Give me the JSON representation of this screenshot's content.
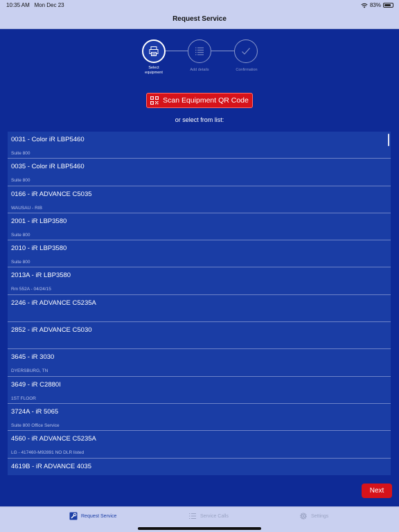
{
  "status_bar": {
    "time": "10:35 AM",
    "date": "Mon Dec 23",
    "battery": "83%",
    "battery_level": 0.83
  },
  "nav": {
    "title": "Request Service"
  },
  "stepper": {
    "steps": [
      {
        "label_line1": "Select",
        "label_line2": "equipment",
        "icon": "printer-icon",
        "state": "active"
      },
      {
        "label_line1": "Add details",
        "label_line2": "",
        "icon": "list-icon",
        "state": "inactive"
      },
      {
        "label_line1": "Confirmation",
        "label_line2": "",
        "icon": "checkmark-icon",
        "state": "inactive"
      }
    ]
  },
  "scan": {
    "label": "Scan Equipment QR Code",
    "icon": "qr-code-icon"
  },
  "or_select": "or select from list:",
  "equipment": [
    {
      "title": "0031 - Color iR LBP5460",
      "sub": "Suite 800"
    },
    {
      "title": "0035 - Color iR LBP5460",
      "sub": "Suite 800"
    },
    {
      "title": "0166 - iR ADVANCE C5035",
      "sub": "WAUSAU - RIB"
    },
    {
      "title": "2001 - iR LBP3580",
      "sub": "Suite 800"
    },
    {
      "title": "2010 - iR LBP3580",
      "sub": "Suite 800"
    },
    {
      "title": "2013A - iR LBP3580",
      "sub": "Rm 552A - 04/24/15"
    },
    {
      "title": "2246 - iR ADVANCE C5235A",
      "sub": ""
    },
    {
      "title": "2852 - iR ADVANCE C5030",
      "sub": ""
    },
    {
      "title": "3645 - iR 3030",
      "sub": "DYERSBURG, TN"
    },
    {
      "title": "3649 - iR C2880I",
      "sub": "1ST FLOOR"
    },
    {
      "title": "3724A - iR 5065",
      "sub": "Suite 800 Office Service"
    },
    {
      "title": "4560 - iR ADVANCE C5235A",
      "sub": "LG - 417460-M92891 NO DLR listed"
    },
    {
      "title": "4619B - iR ADVANCE 4035",
      "sub": ""
    }
  ],
  "next_label": "Next",
  "tabs": [
    {
      "label": "Request Service",
      "icon": "wrench-icon",
      "active": true
    },
    {
      "label": "Service Calls",
      "icon": "list-icon",
      "active": false
    },
    {
      "label": "Settings",
      "icon": "gear-icon",
      "active": false
    }
  ],
  "colors": {
    "background": "#0e2a96",
    "list_bg": "#1a3da5",
    "accent_red": "#d6131a",
    "bar_bg": "#c9d0f0"
  }
}
